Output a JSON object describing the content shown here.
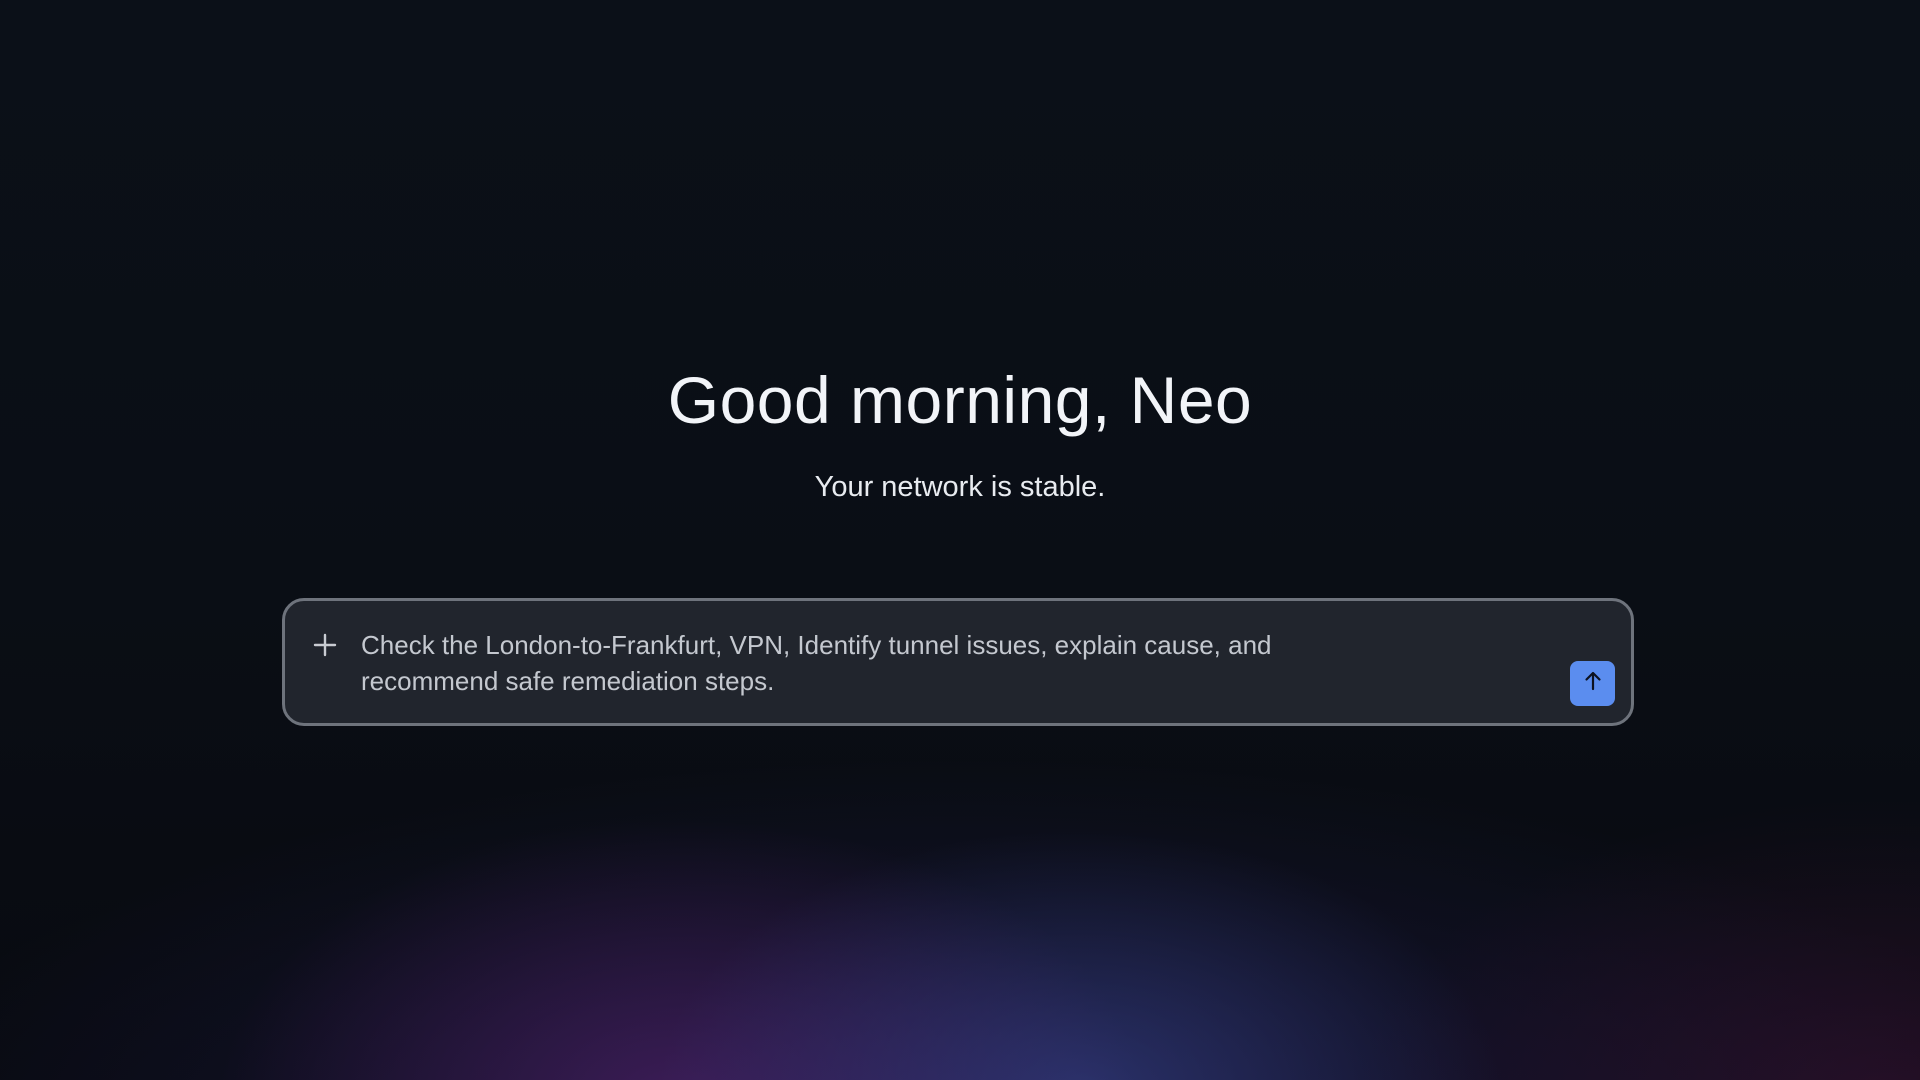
{
  "greeting": {
    "title": "Good morning, Neo",
    "subtitle": "Your network is stable."
  },
  "composer": {
    "attach_icon": "plus-icon",
    "prompt_text": "Check the London-to-Frankfurt, VPN, Identify tunnel issues, explain cause, and\nrecommend safe remediation steps.",
    "send_icon": "arrow-up-icon",
    "send_color": "#5b8def"
  },
  "colors": {
    "background": "#0a0e15",
    "composer_background": "#21252d",
    "composer_border": "#6e737c",
    "text_primary": "#f2f4f8",
    "text_secondary": "#c4c8cf"
  }
}
